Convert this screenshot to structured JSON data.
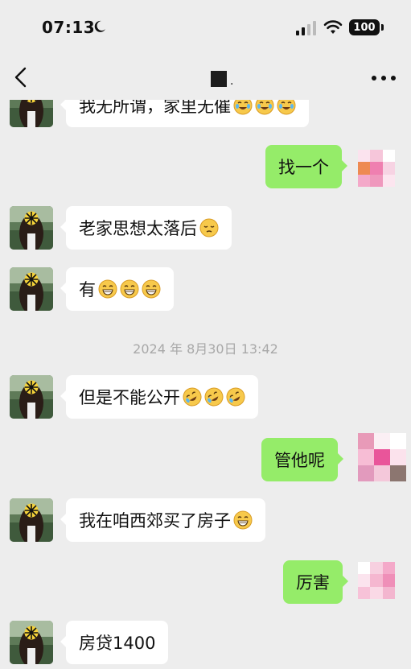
{
  "status_bar": {
    "time": "07:13",
    "battery": "100"
  },
  "nav": {
    "title_suffix": "."
  },
  "messages": {
    "m0": {
      "text": "我无所谓，家里无催",
      "emoji": "crying-laughing"
    },
    "m1": {
      "text": "找一个"
    },
    "m2": {
      "text": "老家思想太落后",
      "emoji": "pensive"
    },
    "m3": {
      "text": "有",
      "emoji": "grinning"
    },
    "m4": {
      "text": "但是不能公开",
      "emoji": "rolling-laughing"
    },
    "m5": {
      "text": "管他呢"
    },
    "m6": {
      "text": "我在咱西郊买了房子",
      "emoji": "grinning"
    },
    "m7": {
      "text": "厉害"
    },
    "m8": {
      "text": "房贷1400"
    }
  },
  "timestamp": "2024 年 8月30日 13:42",
  "colors": {
    "background": "#ededed",
    "bubble_self": "#95ec69",
    "bubble_other": "#ffffff",
    "timestamp": "#a8a8a8"
  }
}
